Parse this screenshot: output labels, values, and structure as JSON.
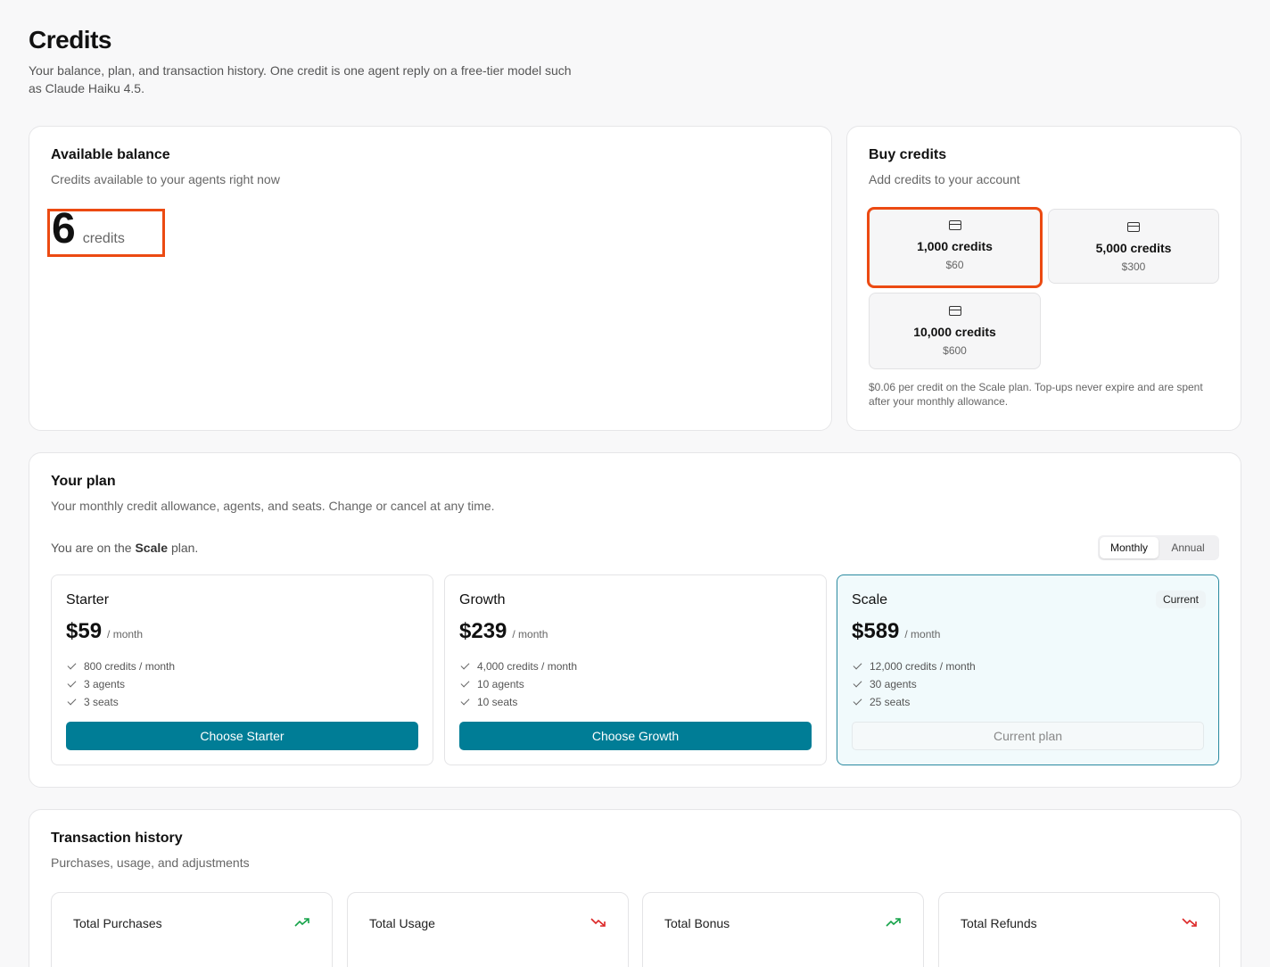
{
  "page": {
    "title": "Credits",
    "subtitle": "Your balance, plan, and transaction history. One credit is one agent reply on a free-tier model such as Claude Haiku 4.5."
  },
  "balance": {
    "title": "Available balance",
    "subtitle": "Credits available to your agents right now",
    "value": "6",
    "unit": "credits"
  },
  "buy": {
    "title": "Buy credits",
    "subtitle": "Add credits to your account",
    "packs": [
      {
        "label": "1,000 credits",
        "price": "$60",
        "icon": "credit-card-icon",
        "selected": true
      },
      {
        "label": "5,000 credits",
        "price": "$300",
        "icon": "credit-card-icon"
      },
      {
        "label": "10,000 credits",
        "price": "$600",
        "icon": "credit-card-icon"
      }
    ],
    "note": "$0.06 per credit on the Scale plan. Top-ups never expire and are spent after your monthly allowance."
  },
  "plan": {
    "title": "Your plan",
    "subtitle": "Your monthly credit allowance, agents, and seats. Change or cancel at any time.",
    "current_prefix": "You are on the",
    "current_name": "Scale",
    "current_suffix": "plan.",
    "billing_options": [
      "Monthly",
      "Annual"
    ],
    "billing_selected": "Monthly",
    "tiers": [
      {
        "name": "Starter",
        "price": "$59",
        "period": "/ month",
        "features": [
          "800 credits / month",
          "3 agents",
          "3 seats"
        ],
        "button": "Choose Starter"
      },
      {
        "name": "Growth",
        "price": "$239",
        "period": "/ month",
        "features": [
          "4,000 credits / month",
          "10 agents",
          "10 seats"
        ],
        "button": "Choose Growth"
      },
      {
        "name": "Scale",
        "price": "$589",
        "period": "/ month",
        "features": [
          "12,000 credits / month",
          "30 agents",
          "25 seats"
        ],
        "button": "Current plan",
        "badge": "Current"
      }
    ]
  },
  "transactions": {
    "title": "Transaction history",
    "subtitle": "Purchases, usage, and adjustments",
    "stats": [
      {
        "label": "Total Purchases",
        "trend": "up",
        "trend_icon": "trending-up-icon",
        "color": "#16a34a"
      },
      {
        "label": "Total Usage",
        "trend": "down",
        "trend_icon": "trending-down-icon",
        "color": "#dc2626"
      },
      {
        "label": "Total Bonus",
        "trend": "up",
        "trend_icon": "trending-up-icon",
        "color": "#16a34a"
      },
      {
        "label": "Total Refunds",
        "trend": "down",
        "trend_icon": "trending-down-icon",
        "color": "#dc2626"
      }
    ]
  },
  "colors": {
    "accent": "#007d96",
    "highlight": "#ec4a12",
    "trend_up": "#16a34a",
    "trend_down": "#dc2626"
  }
}
